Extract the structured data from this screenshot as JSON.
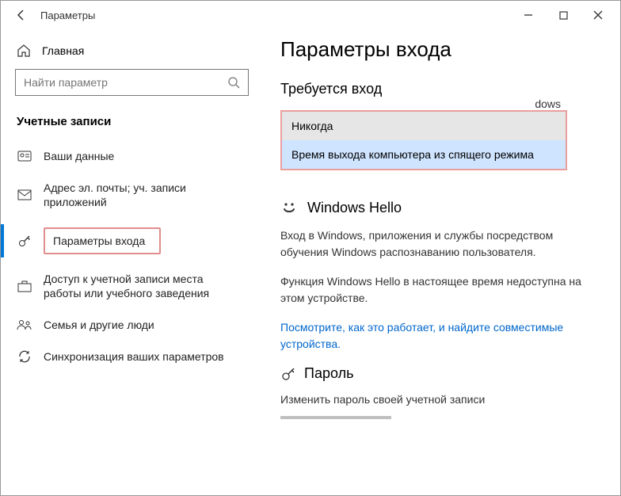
{
  "titlebar": {
    "title": "Параметры"
  },
  "sidebar": {
    "home_label": "Главная",
    "search_placeholder": "Найти параметр",
    "category": "Учетные записи",
    "items": [
      {
        "label": "Ваши данные"
      },
      {
        "label": "Адрес эл. почты; уч. записи приложений"
      },
      {
        "label": "Параметры входа"
      },
      {
        "label": "Доступ к учетной записи места работы или учебного заведения"
      },
      {
        "label": "Семья и другие люди"
      },
      {
        "label": "Синхронизация ваших параметров"
      }
    ]
  },
  "main": {
    "title": "Параметры входа",
    "require_signin": "Требуется вход",
    "cutoff": "dows",
    "options": {
      "never": "Никогда",
      "sleep": "Время выхода компьютера из спящего режима"
    },
    "hello_title": "Windows Hello",
    "hello_desc": "Вход в Windows, приложения и службы посредством обучения Windows распознаванию пользователя.",
    "hello_unavail": "Функция Windows Hello в настоящее время недоступна на этом устройстве.",
    "hello_link": "Посмотрите, как это работает, и найдите совместимые устройства.",
    "password_title": "Пароль",
    "password_desc": "Изменить пароль своей учетной записи"
  }
}
